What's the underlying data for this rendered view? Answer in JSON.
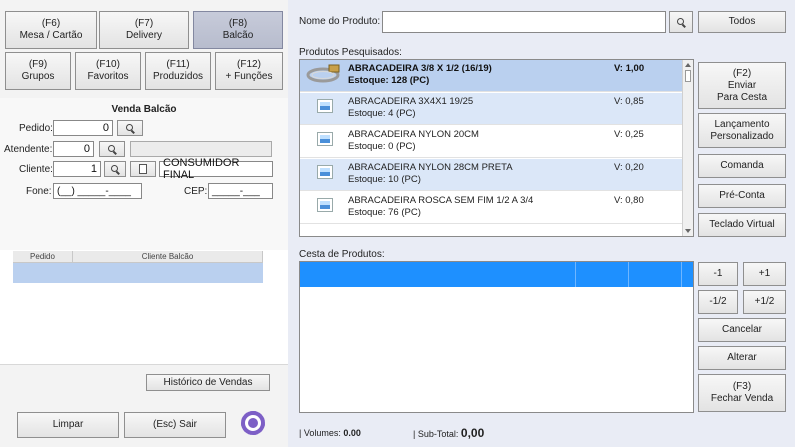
{
  "modes": {
    "mesa": {
      "key": "(F6)",
      "label": "Mesa / Cartão"
    },
    "delivery": {
      "key": "(F7)",
      "label": "Delivery"
    },
    "balcao": {
      "key": "(F8)",
      "label": "Balcão"
    },
    "grupos": {
      "key": "(F9)",
      "label": "Grupos"
    },
    "favoritos": {
      "key": "(F10)",
      "label": "Favoritos"
    },
    "produzidos": {
      "key": "(F11)",
      "label": "Produzidos"
    },
    "funcoes": {
      "key": "(F12)",
      "label": "+ Funções"
    }
  },
  "venda": {
    "title": "Venda Balcão",
    "pedido_label": "Pedido:",
    "pedido_value": "0",
    "atendente_label": "Atendente:",
    "atendente_value": "0",
    "atendente_name": "",
    "cliente_label": "Cliente:",
    "cliente_value": "1",
    "cliente_name": "CONSUMIDOR FINAL",
    "fone_label": "Fone:",
    "fone_value": "(__) _____-____",
    "cep_label": "CEP:",
    "cep_value": "_____-___"
  },
  "pedidos_table": {
    "columns": [
      "Pedido",
      "Cliente Balcão"
    ]
  },
  "left_footer": {
    "historico": "Histórico de Vendas",
    "limpar": "Limpar",
    "sair": "(Esc) Sair"
  },
  "search": {
    "label": "Nome do Produto:",
    "value": "",
    "todos": "Todos"
  },
  "produtos": {
    "label": "Produtos Pesquisados:",
    "items": [
      {
        "name": "ABRACADEIRA 3/8 X 1/2 (16/19)",
        "stock": "Estoque: 128 (PC)",
        "price": "V: 1,00"
      },
      {
        "name": "ABRACADEIRA 3X4X1 19/25",
        "stock": "Estoque: 4 (PC)",
        "price": "V: 0,85"
      },
      {
        "name": "ABRACADEIRA NYLON 20CM",
        "stock": "Estoque: 0 (PC)",
        "price": "V: 0,25"
      },
      {
        "name": "ABRACADEIRA NYLON 28CM PRETA",
        "stock": "Estoque: 10 (PC)",
        "price": "V: 0,20"
      },
      {
        "name": "ABRACADEIRA ROSCA SEM FIM 1/2 A 3/4",
        "stock": "Estoque: 76 (PC)",
        "price": "V: 0,80"
      }
    ]
  },
  "side_actions": {
    "enviar_key": "(F2)",
    "enviar_l1": "Enviar",
    "enviar_l2": "Para Cesta",
    "lanc_l1": "Lançamento",
    "lanc_l2": "Personalizado",
    "comanda": "Comanda",
    "preconta": "Pré-Conta",
    "teclado": "Teclado Virtual"
  },
  "cesta": {
    "label": "Cesta de Produtos:"
  },
  "cesta_actions": {
    "minus1": "-1",
    "plus1": "+1",
    "minushalf": "-1/2",
    "plushalf": "+1/2",
    "cancelar": "Cancelar",
    "alterar": "Alterar",
    "fechar_key": "(F3)",
    "fechar": "Fechar Venda"
  },
  "status": {
    "volumes_label": "| Volumes:",
    "volumes_value": "0.00",
    "subtotal_label": "| Sub-Total:",
    "subtotal_value": "0,00"
  },
  "colors": {
    "selected_row": "#bad0ef",
    "cesta_header": "#1e90ff",
    "gear": "#7d5fc6"
  }
}
